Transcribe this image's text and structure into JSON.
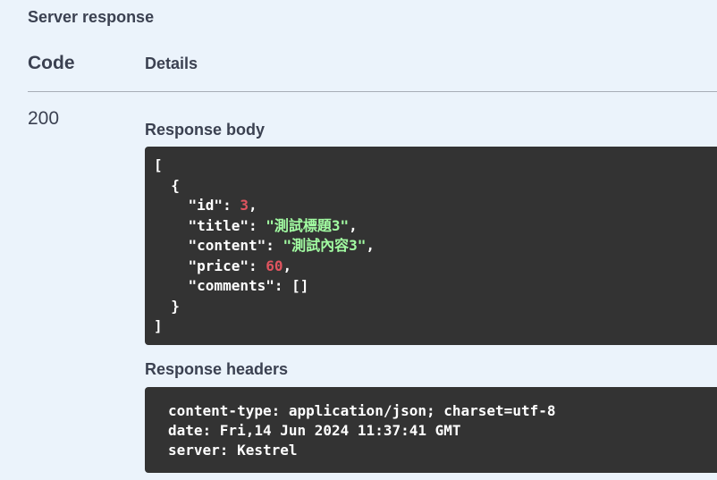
{
  "section_title": "Server response",
  "table": {
    "code_header": "Code",
    "details_header": "Details"
  },
  "response": {
    "status_code": "200",
    "body_label": "Response body",
    "body_json": {
      "open_bracket": "[",
      "open_brace": "{",
      "fields": [
        {
          "key": "\"id\"",
          "value": "3",
          "kind": "num",
          "comma": ","
        },
        {
          "key": "\"title\"",
          "value": "\"測試標題3\"",
          "kind": "str",
          "comma": ","
        },
        {
          "key": "\"content\"",
          "value": "\"測試內容3\"",
          "kind": "str",
          "comma": ","
        },
        {
          "key": "\"price\"",
          "value": "60",
          "kind": "num",
          "comma": ","
        },
        {
          "key": "\"comments\"",
          "value": "[]",
          "kind": "plain",
          "comma": ""
        }
      ],
      "close_brace": "}",
      "close_bracket": "]"
    },
    "headers_label": "Response headers",
    "headers": [
      "content-type: application/json; charset=utf-8",
      "date: Fri,14 Jun 2024 11:37:41 GMT",
      "server: Kestrel"
    ]
  },
  "colors": {
    "background": "#ebf3fb",
    "code_background": "#333333",
    "number": "#e0545f",
    "string": "#a2fca2",
    "text": "#3b4151"
  }
}
